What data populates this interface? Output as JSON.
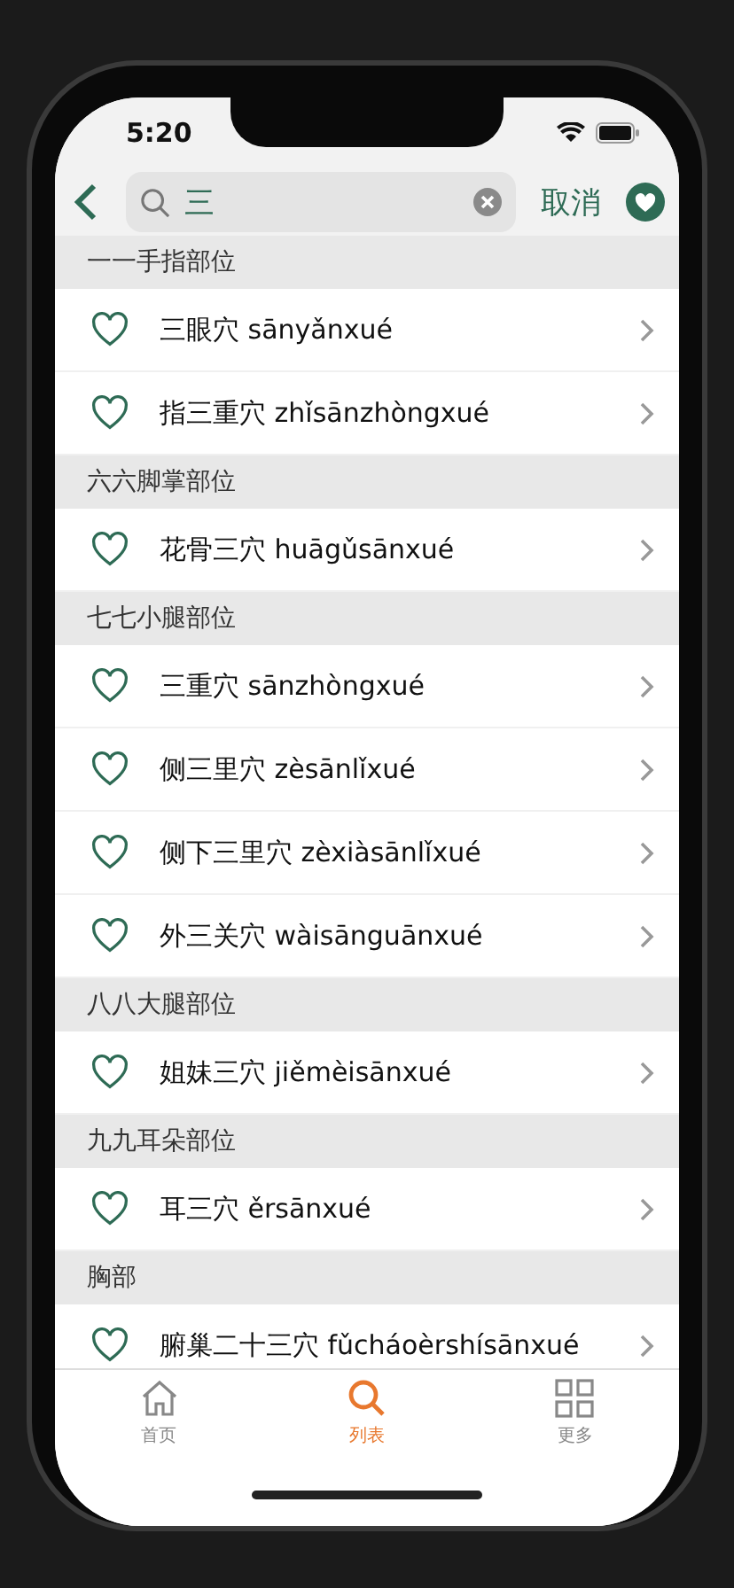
{
  "status_bar": {
    "time": "5:20"
  },
  "search": {
    "value": "三",
    "cancel": "取消"
  },
  "sections": [
    {
      "title": "一一手指部位",
      "items": [
        {
          "name": "三眼穴 sānyǎnxué",
          "favorite": false
        },
        {
          "name": "指三重穴 zhǐsānzhòngxué",
          "favorite": false
        }
      ]
    },
    {
      "title": "六六脚掌部位",
      "items": [
        {
          "name": "花骨三穴 huāgǔsānxué",
          "favorite": false
        }
      ]
    },
    {
      "title": "七七小腿部位",
      "items": [
        {
          "name": "三重穴 sānzhòngxué",
          "favorite": false
        },
        {
          "name": "侧三里穴 zèsānlǐxué",
          "favorite": false
        },
        {
          "name": "侧下三里穴 zèxiàsānlǐxué",
          "favorite": false
        },
        {
          "name": "外三关穴 wàisānguānxué",
          "favorite": false
        }
      ]
    },
    {
      "title": "八八大腿部位",
      "items": [
        {
          "name": "姐妹三穴 jiěmèisānxué",
          "favorite": false
        }
      ]
    },
    {
      "title": "九九耳朵部位",
      "items": [
        {
          "name": "耳三穴 ěrsānxué",
          "favorite": false
        }
      ]
    },
    {
      "title": "胸部",
      "items": [
        {
          "name": "腑巢二十三穴 fǔcháoèrshísānxué",
          "favorite": false
        }
      ]
    }
  ],
  "tab_bar": [
    {
      "kind": "home",
      "label": "首页",
      "selected": false
    },
    {
      "kind": "search",
      "label": "列表",
      "selected": true
    },
    {
      "kind": "grid",
      "label": "更多",
      "selected": false
    }
  ]
}
